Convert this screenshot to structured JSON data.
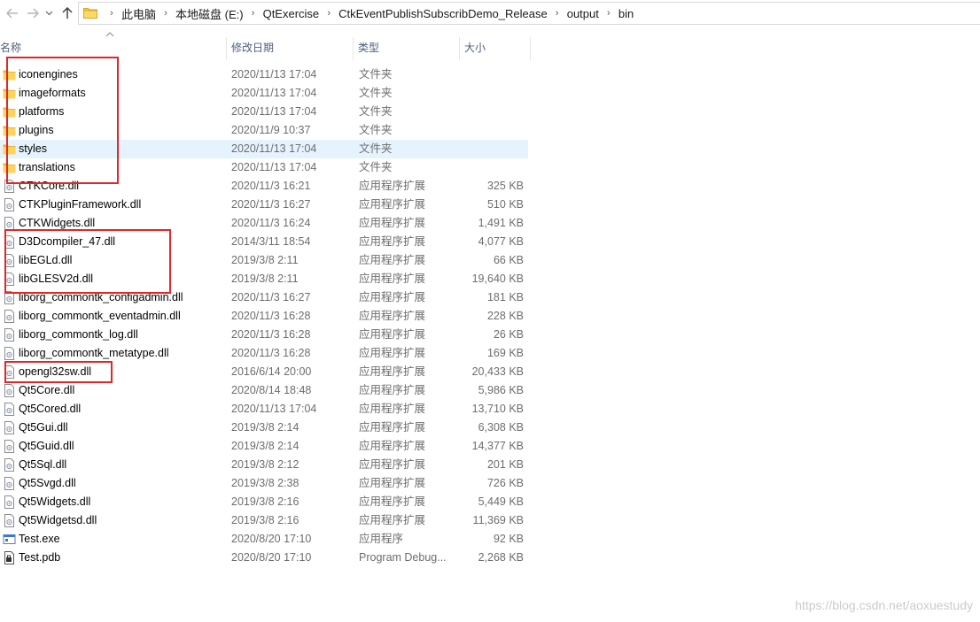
{
  "breadcrumb": [
    "此电脑",
    "本地磁盘 (E:)",
    "QtExercise",
    "CtkEventPublishSubscribDemo_Release",
    "output",
    "bin"
  ],
  "columns": {
    "name": "名称",
    "date": "修改日期",
    "type": "类型",
    "size": "大小"
  },
  "files": [
    {
      "name": "iconengines",
      "date": "2020/11/13 17:04",
      "type": "文件夹",
      "size": "",
      "icon": "folder-icon"
    },
    {
      "name": "imageformats",
      "date": "2020/11/13 17:04",
      "type": "文件夹",
      "size": "",
      "icon": "folder-icon"
    },
    {
      "name": "platforms",
      "date": "2020/11/13 17:04",
      "type": "文件夹",
      "size": "",
      "icon": "folder-icon"
    },
    {
      "name": "plugins",
      "date": "2020/11/9 10:37",
      "type": "文件夹",
      "size": "",
      "icon": "folder-icon"
    },
    {
      "name": "styles",
      "date": "2020/11/13 17:04",
      "type": "文件夹",
      "size": "",
      "icon": "folder-icon",
      "hover": true
    },
    {
      "name": "translations",
      "date": "2020/11/13 17:04",
      "type": "文件夹",
      "size": "",
      "icon": "folder-icon"
    },
    {
      "name": "CTKCore.dll",
      "date": "2020/11/3 16:21",
      "type": "应用程序扩展",
      "size": "325 KB",
      "icon": "dll-file-icon"
    },
    {
      "name": "CTKPluginFramework.dll",
      "date": "2020/11/3 16:27",
      "type": "应用程序扩展",
      "size": "510 KB",
      "icon": "dll-file-icon"
    },
    {
      "name": "CTKWidgets.dll",
      "date": "2020/11/3 16:24",
      "type": "应用程序扩展",
      "size": "1,491 KB",
      "icon": "dll-file-icon"
    },
    {
      "name": "D3Dcompiler_47.dll",
      "date": "2014/3/11 18:54",
      "type": "应用程序扩展",
      "size": "4,077 KB",
      "icon": "dll-file-icon"
    },
    {
      "name": "libEGLd.dll",
      "date": "2019/3/8 2:11",
      "type": "应用程序扩展",
      "size": "66 KB",
      "icon": "dll-file-icon"
    },
    {
      "name": "libGLESV2d.dll",
      "date": "2019/3/8 2:11",
      "type": "应用程序扩展",
      "size": "19,640 KB",
      "icon": "dll-file-icon"
    },
    {
      "name": "liborg_commontk_configadmin.dll",
      "date": "2020/11/3 16:27",
      "type": "应用程序扩展",
      "size": "181 KB",
      "icon": "dll-file-icon"
    },
    {
      "name": "liborg_commontk_eventadmin.dll",
      "date": "2020/11/3 16:28",
      "type": "应用程序扩展",
      "size": "228 KB",
      "icon": "dll-file-icon"
    },
    {
      "name": "liborg_commontk_log.dll",
      "date": "2020/11/3 16:28",
      "type": "应用程序扩展",
      "size": "26 KB",
      "icon": "dll-file-icon"
    },
    {
      "name": "liborg_commontk_metatype.dll",
      "date": "2020/11/3 16:28",
      "type": "应用程序扩展",
      "size": "169 KB",
      "icon": "dll-file-icon"
    },
    {
      "name": "opengl32sw.dll",
      "date": "2016/6/14 20:00",
      "type": "应用程序扩展",
      "size": "20,433 KB",
      "icon": "dll-file-icon"
    },
    {
      "name": "Qt5Core.dll",
      "date": "2020/8/14 18:48",
      "type": "应用程序扩展",
      "size": "5,986 KB",
      "icon": "dll-file-icon"
    },
    {
      "name": "Qt5Cored.dll",
      "date": "2020/11/13 17:04",
      "type": "应用程序扩展",
      "size": "13,710 KB",
      "icon": "dll-file-icon"
    },
    {
      "name": "Qt5Gui.dll",
      "date": "2019/3/8 2:14",
      "type": "应用程序扩展",
      "size": "6,308 KB",
      "icon": "dll-file-icon"
    },
    {
      "name": "Qt5Guid.dll",
      "date": "2019/3/8 2:14",
      "type": "应用程序扩展",
      "size": "14,377 KB",
      "icon": "dll-file-icon"
    },
    {
      "name": "Qt5Sql.dll",
      "date": "2019/3/8 2:12",
      "type": "应用程序扩展",
      "size": "201 KB",
      "icon": "dll-file-icon"
    },
    {
      "name": "Qt5Svgd.dll",
      "date": "2019/3/8 2:38",
      "type": "应用程序扩展",
      "size": "726 KB",
      "icon": "dll-file-icon"
    },
    {
      "name": "Qt5Widgets.dll",
      "date": "2019/3/8 2:16",
      "type": "应用程序扩展",
      "size": "5,449 KB",
      "icon": "dll-file-icon"
    },
    {
      "name": "Qt5Widgetsd.dll",
      "date": "2019/3/8 2:16",
      "type": "应用程序扩展",
      "size": "11,369 KB",
      "icon": "dll-file-icon"
    },
    {
      "name": "Test.exe",
      "date": "2020/8/20 17:10",
      "type": "应用程序",
      "size": "92 KB",
      "icon": "exe-file-icon"
    },
    {
      "name": "Test.pdb",
      "date": "2020/8/20 17:10",
      "type": "Program Debug...",
      "size": "2,268 KB",
      "icon": "pdb-file-icon"
    }
  ],
  "colors": {
    "annotation": "#e0282a",
    "hover_row": "#e5f3ff",
    "folder": "#f6c84c"
  },
  "watermark": "https://blog.csdn.net/aoxuestudy"
}
